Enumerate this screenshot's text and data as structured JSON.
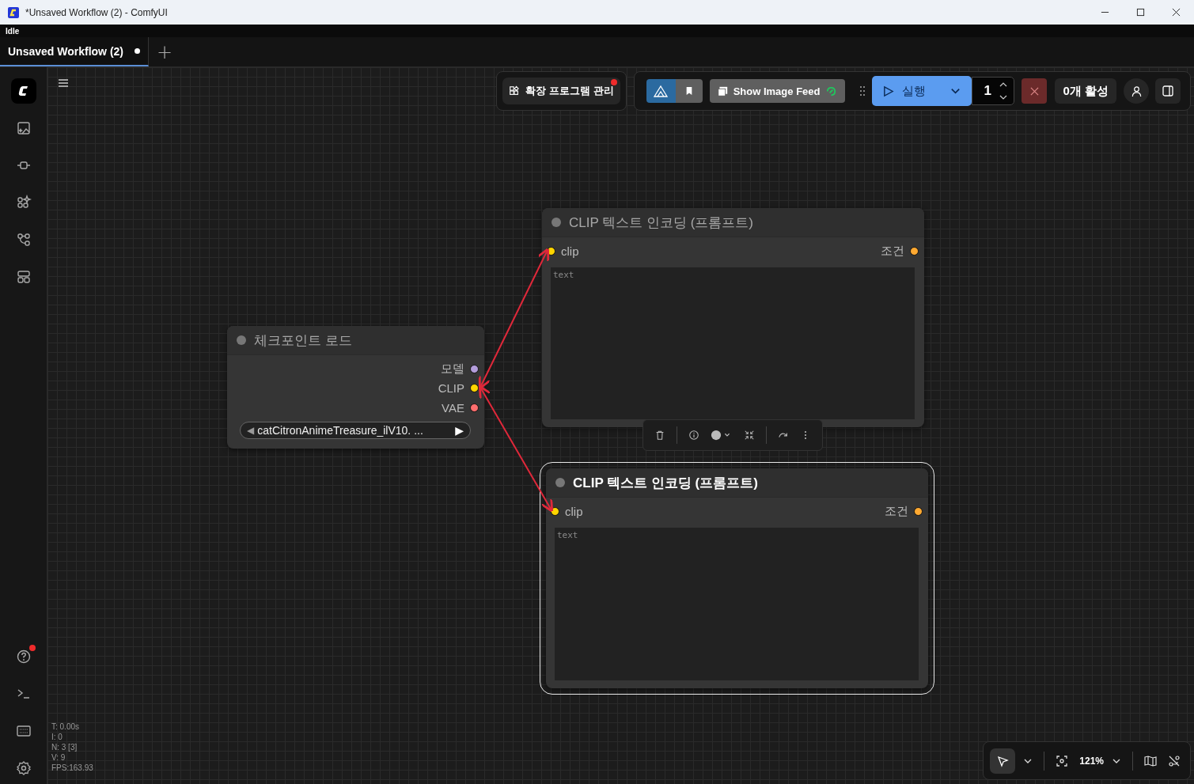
{
  "window": {
    "title": "*Unsaved Workflow (2) - ComfyUI"
  },
  "status": "Idle",
  "tabs": [
    {
      "label": "Unsaved Workflow (2)",
      "selected": true,
      "modified": true
    }
  ],
  "new_tab": "+",
  "sidebar": {
    "top": [
      {
        "kind": "images"
      },
      {
        "kind": "models"
      },
      {
        "kind": "nodes"
      },
      {
        "kind": "workflows"
      },
      {
        "kind": "templates"
      }
    ],
    "bottom": [
      {
        "kind": "help",
        "notification": true
      },
      {
        "kind": "terminal"
      },
      {
        "kind": "keyboard"
      },
      {
        "kind": "settings"
      }
    ]
  },
  "toolbar": {
    "extensions": {
      "label": "확장 프로그램 관리",
      "notification": true
    },
    "image_feed": "Show Image Feed",
    "run": "실행",
    "batch_count": "1",
    "active_jobs": "0개 활성"
  },
  "nodes": [
    {
      "title": "체크포인트 로드",
      "selected": false,
      "outputs": [
        {
          "label": "모델",
          "color": "#b39ddb"
        },
        {
          "label": "CLIP",
          "color": "#ffd500",
          "connected": true
        },
        {
          "label": "VAE",
          "color": "#ff6e6e"
        }
      ],
      "widget": {
        "prev": "◀",
        "value": "catCitronAnimeTreasure_ilV10. ...",
        "next": "▶"
      }
    },
    {
      "title": "CLIP 텍스트 인코딩 (프롬프트)",
      "selected": false,
      "inputs": [
        {
          "label": "clip",
          "color": "#ffd500",
          "connected": true
        }
      ],
      "outputs": [
        {
          "label": "조건",
          "color": "#ffa931"
        }
      ],
      "textarea": {
        "placeholder": "text"
      }
    },
    {
      "title": "CLIP 텍스트 인코딩 (프롬프트)",
      "selected": true,
      "inputs": [
        {
          "label": "clip",
          "color": "#ffd500",
          "connected": true
        }
      ],
      "outputs": [
        {
          "label": "조건",
          "color": "#ffa931"
        }
      ],
      "textarea": {
        "placeholder": "text"
      }
    }
  ],
  "stats": [
    "T: 0.00s",
    "I: 0",
    "N: 3 [3]",
    "V: 9",
    "FPS:163.93"
  ],
  "zoom": "121%"
}
